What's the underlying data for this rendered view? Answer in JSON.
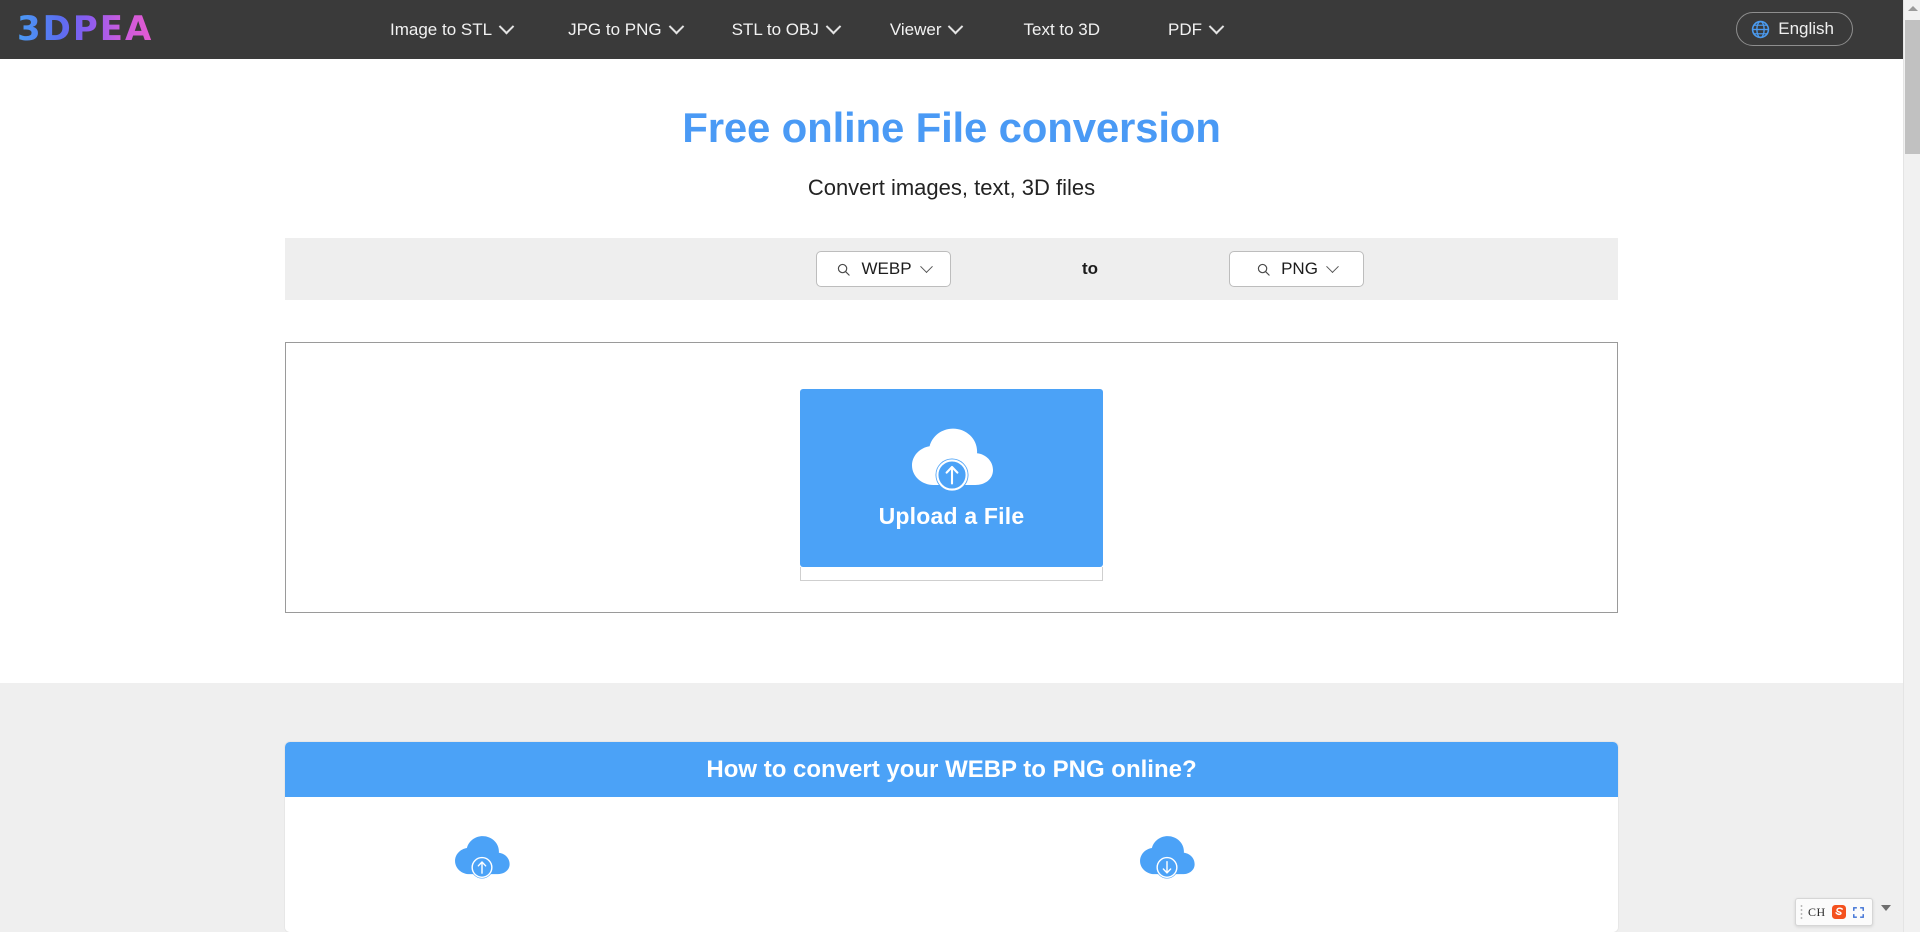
{
  "brand": {
    "logo_text": "3DPEA",
    "gradient_from": "#4a9cf5",
    "gradient_to": "#e65ad0"
  },
  "nav": {
    "items": [
      {
        "label": "Image to STL",
        "has_dropdown": true
      },
      {
        "label": "JPG to PNG",
        "has_dropdown": true
      },
      {
        "label": "STL to OBJ",
        "has_dropdown": true
      },
      {
        "label": "Viewer",
        "has_dropdown": true
      },
      {
        "label": "Text to 3D",
        "has_dropdown": false
      },
      {
        "label": "PDF",
        "has_dropdown": true
      }
    ],
    "language": {
      "label": "English",
      "icon": "globe-icon"
    },
    "background": "#3a3a3a"
  },
  "hero": {
    "title": "Free online File conversion",
    "subtitle": "Convert images, text, 3D files",
    "title_color": "#4a9af5"
  },
  "converter": {
    "source_format": "WEBP",
    "target_format": "PNG",
    "separator_label": "to",
    "source_icon": "search-icon",
    "target_icon": "search-icon",
    "bar_background": "#eeeeee"
  },
  "upload": {
    "button_label": "Upload a File",
    "icon": "cloud-upload-icon",
    "accent_color": "#4ba2f7"
  },
  "howto": {
    "heading": "How to convert your WEBP to PNG online?",
    "heading_bg": "#4ba2f7",
    "steps": [
      {
        "icon": "cloud-upload-icon"
      },
      {
        "icon": "cloud-download-icon"
      }
    ]
  },
  "scrollbar": {
    "up_arrow_icon": "scroll-up-arrow-icon"
  },
  "ime": {
    "mode_label": "CH",
    "logo_icon": "sogou-s-icon",
    "keyboard_icon": "soft-keyboard-icon",
    "expand_icon": "chevron-down-icon"
  }
}
